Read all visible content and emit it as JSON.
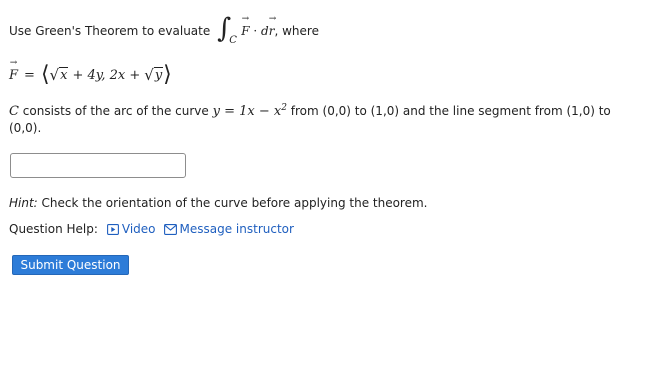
{
  "question": {
    "intro_text": "Use Green's Theorem to evaluate",
    "integral_symbol": "∫",
    "integral_subscript": "C",
    "integrand_F": "F",
    "integrand_dot": "·",
    "integrand_d": "d",
    "integrand_r": "r",
    "intro_suffix": ", where",
    "field_F": "F",
    "field_equals": "=",
    "field_langle": "⟨",
    "field_rangle": "⟩",
    "field_sqrt_x": "x",
    "field_comp1_rest": "+ 4y, 2x +",
    "field_sqrt_y": "y",
    "curve_C": "C",
    "curve_text_1": "consists of the arc of the curve",
    "curve_equation": "y = 1x − x",
    "curve_exponent": "2",
    "curve_text_2": "from (0,0) to (1,0) and the line segment from (1,0) to (0,0)."
  },
  "answer": {
    "value": "",
    "placeholder": ""
  },
  "hint": {
    "label": "Hint:",
    "text": "Check the orientation of the curve before applying the theorem."
  },
  "help": {
    "label": "Question Help:",
    "video_label": "Video",
    "message_label": "Message instructor"
  },
  "submit": {
    "label": "Submit Question"
  },
  "colors": {
    "link": "#1f5fbf",
    "button": "#2d7cd8",
    "text": "#222222"
  },
  "icons": {
    "video": "play-video-icon",
    "message": "envelope-icon"
  }
}
